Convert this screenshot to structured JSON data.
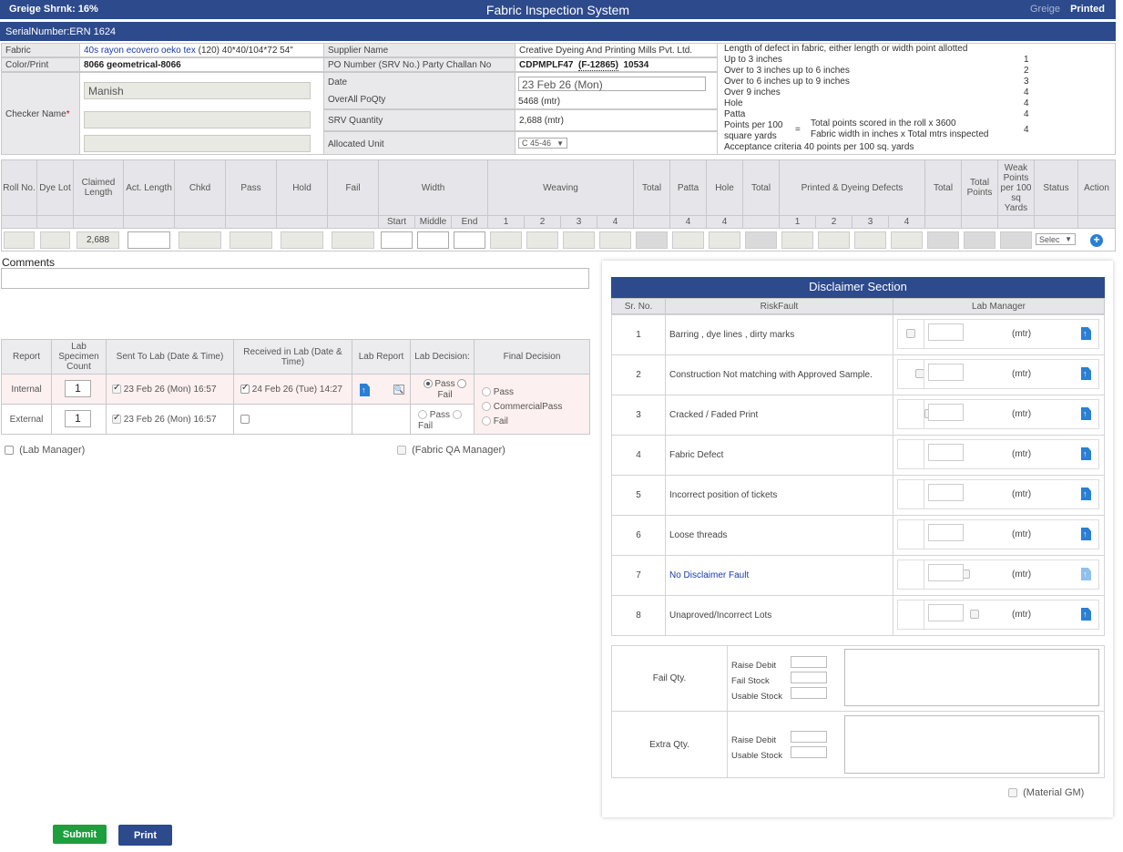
{
  "header": {
    "greige_shrink": "Greige Shrnk: 16%",
    "title": "Fabric Inspection System",
    "mode_greige": "Greige",
    "mode_printed": "Printed",
    "serial": "SerialNumber:ERN 1624"
  },
  "info": {
    "fabric_label": "Fabric",
    "fabric_value": "40s rayon ecovero oeko tex",
    "fabric_extra": "(120) 40*40/104*72 54\"",
    "color_label": "Color/Print",
    "color_value": "8066 geometrical-8066",
    "checker_label": "Checker Name",
    "checker_required": "*",
    "checker_value": "Manish",
    "supplier_label": "Supplier Name",
    "supplier_value": "Creative Dyeing And Printing Mills Pvt. Ltd.",
    "po_label": "PO Number (SRV No.) Party Challan No",
    "po_value": "CDPMPLF47",
    "po_srv": "(F-12865)",
    "po_challan": "10534",
    "date_label": "Date",
    "date_value": "23 Feb 26 (Mon)",
    "poqty_label": "OverAll PoQty",
    "poqty_value": "5468 (mtr)",
    "srv_label": "SRV Quantity",
    "srv_value": "2,688 (mtr)",
    "unit_label": "Allocated Unit",
    "unit_value": "C 45-46"
  },
  "defects": {
    "intro": "Length of defect in fabric, either length or width point allotted",
    "rows": [
      {
        "label": "Up to 3 inches",
        "points": "1"
      },
      {
        "label": "Over to 3 inches up to 6 inches",
        "points": "2"
      },
      {
        "label": "Over to 6 inches up to 9 inches",
        "points": "3"
      },
      {
        "label": "Over 9 inches",
        "points": "4"
      },
      {
        "label": "Hole",
        "points": "4"
      },
      {
        "label": "Patta",
        "points": "4"
      }
    ],
    "formula_left_1": "Points per 100",
    "formula_left_2": "square yards",
    "formula_eq": "=",
    "formula_num": "Total points scored in the roll x 3600",
    "formula_den": "Fabric width in inches x Total mtrs inspected",
    "formula_points": "4",
    "acceptance": "Acceptance criteria 40 points per 100 sq. yards"
  },
  "grid": {
    "headers": {
      "roll": "Roll No.",
      "dye_lot": "Dye Lot",
      "claimed": "Claimed Length",
      "act_length": "Act. Length",
      "chkd": "Chkd",
      "pass": "Pass",
      "hold": "Hold",
      "fail": "Fail",
      "width": "Width",
      "weaving": "Weaving",
      "total1": "Total",
      "patta": "Patta",
      "hole": "Hole",
      "total2": "Total",
      "pd_defects": "Printed & Dyeing Defects",
      "total3": "Total",
      "total_points": "Total Points",
      "weak_points": "Weak Points per 100 sq Yards",
      "status": "Status",
      "action": "Action"
    },
    "sub": {
      "start": "Start",
      "middle": "Middle",
      "end": "End",
      "w1": "1",
      "w2": "2",
      "w3": "3",
      "w4": "4",
      "patta": "4",
      "hole": "4",
      "p1": "1",
      "p2": "2",
      "p3": "3",
      "p4": "4"
    },
    "row": {
      "claimed": "2,688",
      "status": "Selec"
    }
  },
  "comments_label": "Comments",
  "lab": {
    "headers": {
      "report": "Report",
      "specimen": "Lab Specimen Count",
      "sent": "Sent To Lab (Date & Time)",
      "received": "Received in Lab (Date & Time)",
      "lab_report": "Lab Report",
      "decision": "Lab Decision:",
      "final": "Final Decision"
    },
    "rows": [
      {
        "report": "Internal",
        "count": "1",
        "sent": "23 Feb 26 (Mon) 16:57",
        "received": "24 Feb 26 (Tue) 14:27",
        "pass": "Pass",
        "fail": "Fail"
      },
      {
        "report": "External",
        "count": "1",
        "sent": "23 Feb 26 (Mon) 16:57",
        "received": "",
        "pass": "Pass",
        "fail": "Fail"
      }
    ],
    "final_options": [
      "Pass",
      "CommercialPass",
      "Fail"
    ],
    "lab_manager": "(Lab Manager)",
    "qa_manager": "(Fabric QA Manager)"
  },
  "disclaimer": {
    "title": "Disclaimer Section",
    "col_sr": "Sr. No.",
    "col_risk": "RiskFault",
    "col_manager": "Lab Manager",
    "unit": "(mtr)",
    "rows": [
      {
        "no": "1",
        "risk": "Barring , dye lines , dirty marks"
      },
      {
        "no": "2",
        "risk": "Construction Not matching with Approved Sample."
      },
      {
        "no": "3",
        "risk": "Cracked / Faded Print"
      },
      {
        "no": "4",
        "risk": "Fabric Defect"
      },
      {
        "no": "5",
        "risk": "Incorrect position of tickets"
      },
      {
        "no": "6",
        "risk": "Loose threads"
      },
      {
        "no": "7",
        "risk": "No Disclaimer Fault"
      },
      {
        "no": "8",
        "risk": "Unaproved/Incorrect Lots"
      }
    ],
    "fail_qty": "Fail Qty.",
    "fail_fields": [
      "Raise Debit",
      "Fail Stock",
      "Usable Stock"
    ],
    "extra_qty": "Extra Qty.",
    "extra_fields": [
      "Raise Debit",
      "Usable Stock"
    ],
    "material_gm": "(Material GM)"
  },
  "actions": {
    "submit": "Submit",
    "print": "Print"
  },
  "colors": {
    "header_bg": "#2c4a8c",
    "submit_bg": "#1e9e3e",
    "print_bg": "#2c4a8c",
    "link_blue": "#1a3aa8"
  }
}
